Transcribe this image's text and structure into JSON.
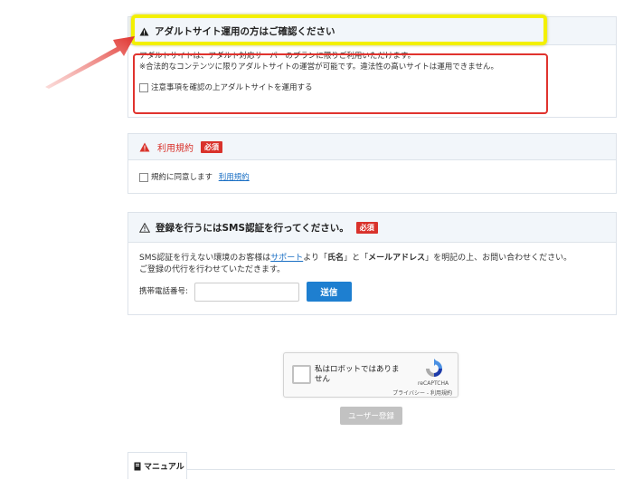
{
  "adult": {
    "title": "アダルトサイト運用の方はご確認ください",
    "line1": "アダルトサイトは、アダルト対応サーバーのプランに限りご利用いただけます。",
    "line2": "※合法的なコンテンツに限りアダルトサイトの運営が可能です。違法性の高いサイトは運用できません。",
    "checkbox_label": "注意事項を確認の上アダルトサイトを運用する"
  },
  "terms": {
    "title": "利用規約",
    "required": "必須",
    "agree_text": "規約に同意します",
    "link": "利用規約"
  },
  "sms": {
    "title": "登録を行うにはSMS認証を行ってください。",
    "required": "必須",
    "text_a": "SMS認証を行えない環境のお客様は",
    "support_link": "サポート",
    "text_b": "より「",
    "name_bold": "氏名",
    "text_c": "」と「",
    "mail_bold": "メールアドレス",
    "text_d": "」を明記の上、お問い合わせください。",
    "line2": "ご登録の代行を行わせていただきます。",
    "phone_label": "携帯電話番号:",
    "phone_value": "",
    "phone_placeholder": "",
    "send_button": "送信"
  },
  "recaptcha": {
    "label": "私はロボットではありません",
    "brand": "reCAPTCHA",
    "links": "プライバシー - 利用規約"
  },
  "register_button": "ユーザー登録",
  "manual_tab": "マニュアル",
  "colors": {
    "accent_blue": "#1e7fd0",
    "required_red": "#d9322b",
    "highlight_yellow": "#f3f000",
    "annotation_red": "#e0332e"
  },
  "icons": [
    "warning-icon",
    "manual-book-icon",
    "recaptcha-logo-icon",
    "annotation-arrow"
  ]
}
